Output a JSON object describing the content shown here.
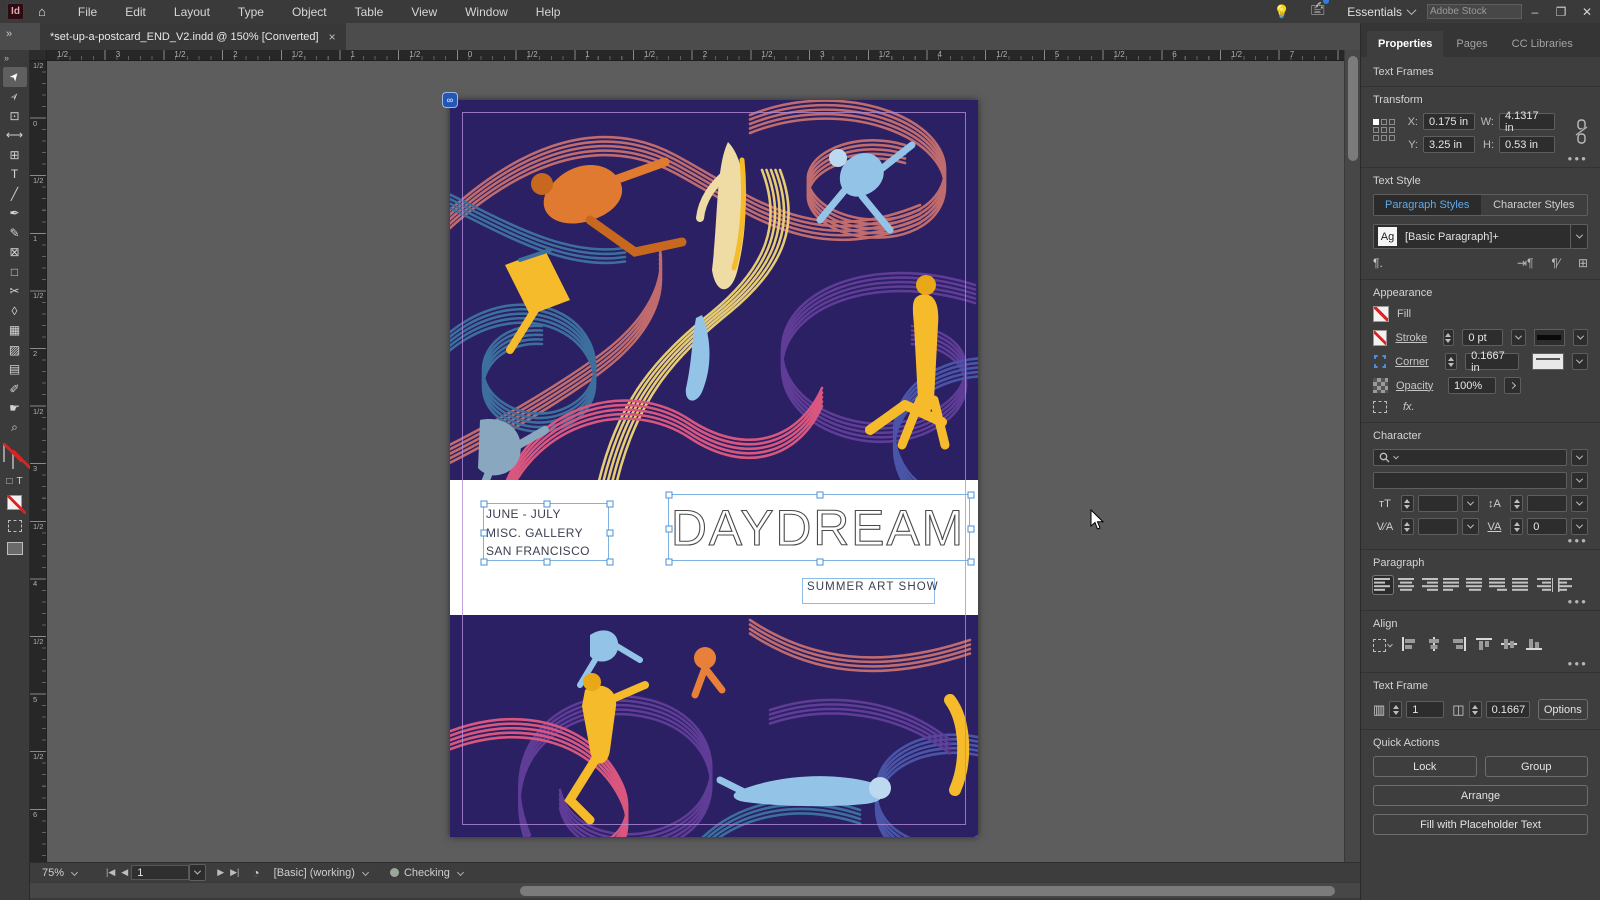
{
  "menu_bar": {
    "app_initials": "Id",
    "items": [
      "File",
      "Edit",
      "Layout",
      "Type",
      "Object",
      "Table",
      "View",
      "Window",
      "Help"
    ],
    "workspace": "Essentials",
    "search_placeholder": "Adobe Stock",
    "minimize": "–",
    "restore": "❐",
    "close": "✕"
  },
  "document_tab": {
    "title": "*set-up-a-postcard_END_V2.indd @ 150% [Converted]",
    "close": "×"
  },
  "rulers": {
    "horizontal": [
      "1/2",
      "3",
      "1/2",
      "2",
      "1/2",
      "1",
      "1/2",
      "0",
      "1/2",
      "1",
      "1/2",
      "2",
      "1/2",
      "3",
      "1/2",
      "4",
      "1/2",
      "5",
      "1/2",
      "6",
      "1/2",
      "7"
    ],
    "vertical": [
      "1/2",
      "0",
      "1/2",
      "1",
      "1/2",
      "2",
      "1/2",
      "3",
      "1/2",
      "4",
      "1/2",
      "5",
      "1/2",
      "6"
    ]
  },
  "toolbar": {
    "expander": "»",
    "tools": [
      {
        "name": "selection-tool",
        "glyph": "➤",
        "active": true
      },
      {
        "name": "direct-selection-tool",
        "glyph": "➢",
        "active": false
      },
      {
        "name": "page-tool",
        "glyph": "⊡",
        "active": false
      },
      {
        "name": "gap-tool",
        "glyph": "⟷",
        "active": false
      },
      {
        "name": "content-collector-tool",
        "glyph": "⊞",
        "active": false
      },
      {
        "name": "type-tool",
        "glyph": "T",
        "active": false
      },
      {
        "name": "line-tool",
        "glyph": "╱",
        "active": false
      },
      {
        "name": "pen-tool",
        "glyph": "✒",
        "active": false
      },
      {
        "name": "pencil-tool",
        "glyph": "✎",
        "active": false
      },
      {
        "name": "rectangle-frame-tool",
        "glyph": "⊠",
        "active": false
      },
      {
        "name": "rectangle-tool",
        "glyph": "□",
        "active": false
      },
      {
        "name": "scissors-tool",
        "glyph": "✂",
        "active": false
      },
      {
        "name": "free-transform-tool",
        "glyph": "◊",
        "active": false
      },
      {
        "name": "gradient-swatch-tool",
        "glyph": "▦",
        "active": false
      },
      {
        "name": "gradient-feather-tool",
        "glyph": "▨",
        "active": false
      },
      {
        "name": "note-tool",
        "glyph": "▤",
        "active": false
      },
      {
        "name": "eyedropper-tool",
        "glyph": "✐",
        "active": false
      },
      {
        "name": "hand-tool",
        "glyph": "☛",
        "active": false
      },
      {
        "name": "zoom-tool",
        "glyph": "⌕",
        "active": false
      }
    ],
    "container_glyph": "□",
    "text_glyph": "T"
  },
  "canvas": {
    "page_badge": "∞",
    "details_lines": [
      "JUNE - JULY",
      "MISC. GALLERY",
      "SAN FRANCISCO"
    ],
    "title": "DAYDREAM",
    "subtitle": "SUMMER ART SHOW"
  },
  "properties": {
    "tabs": [
      "Properties",
      "Pages",
      "CC Libraries"
    ],
    "selection_type": "Text Frames",
    "transform": {
      "heading": "Transform",
      "x_label": "X:",
      "x": "0.175 in",
      "y_label": "Y:",
      "y": "3.25 in",
      "w_label": "W:",
      "w": "4.1317 in",
      "h_label": "H:",
      "h": "0.53 in"
    },
    "text_style": {
      "heading": "Text Style",
      "tab_paragraph": "Paragraph Styles",
      "tab_character": "Character Styles",
      "style_sample": "Ag",
      "style_name": "[Basic Paragraph]+",
      "pilcrow": "¶."
    },
    "appearance": {
      "heading": "Appearance",
      "fill": "Fill",
      "stroke": "Stroke",
      "stroke_weight": "0 pt",
      "corner": "Corner",
      "corner_radius": "0.1667 in",
      "opacity": "Opacity",
      "opacity_value": "100%",
      "fx": "fx."
    },
    "character": {
      "heading": "Character",
      "font_size_icon": "тT",
      "leading_icon": "↕A",
      "kerning_icon": "V∕A",
      "tracking_icon": "VA",
      "tracking_value": "0"
    },
    "paragraph": {
      "heading": "Paragraph"
    },
    "align": {
      "heading": "Align"
    },
    "text_frame": {
      "heading": "Text Frame",
      "columns_value": "1",
      "gutter_value": "0.1667",
      "options_label": "Options"
    },
    "quick_actions": {
      "heading": "Quick Actions",
      "lock": "Lock",
      "group": "Group",
      "arrange": "Arrange",
      "fill_placeholder": "Fill with Placeholder Text"
    }
  },
  "status_bar": {
    "zoom": "75%",
    "first_page": "|◀",
    "prev_page": "◀",
    "page": "1",
    "next_page": "▶",
    "last_page": "▶|",
    "preflight_icon": "◔",
    "preset": "[Basic] (working)",
    "preflight_status": "Checking"
  },
  "colors": {
    "accent_blue": "#3f8ae0",
    "selection_blue": "#7fb2e0",
    "art_background": "#2a2063",
    "salmon": "#c06b6e",
    "steel_blue": "#3d6f9e",
    "golden": "#e6cc74",
    "purple": "#5f3c96",
    "magenta": "#d9577f",
    "royal_blue": "#4a55a8",
    "orange": "#e07a30",
    "light_blue": "#93c4e8",
    "cream": "#eedca4",
    "yellow": "#f6bb2a",
    "margin_guide": "#b28cd8"
  }
}
